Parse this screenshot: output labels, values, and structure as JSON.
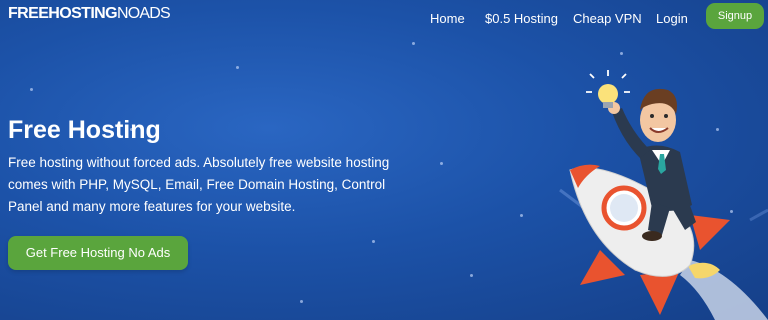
{
  "header": {
    "logo_bold": "FREEHOSTING",
    "logo_thin": "NOADS",
    "nav": [
      {
        "label": "Home"
      },
      {
        "label": "$0.5 Hosting"
      },
      {
        "label": "Cheap VPN"
      },
      {
        "label": "Login"
      }
    ],
    "signup_label": "Signup"
  },
  "hero": {
    "title": "Free Hosting",
    "description": "Free hosting without forced ads. Absolutely free website hosting comes with PHP, MySQL, Email, Free Domain Hosting, Control Panel and many more features for your website.",
    "cta_label": "Get Free Hosting No Ads",
    "illustration": "businessman-on-rocket"
  },
  "colors": {
    "background": "#1c52a8",
    "accent_green": "#5aa53d",
    "text": "#ffffff"
  }
}
